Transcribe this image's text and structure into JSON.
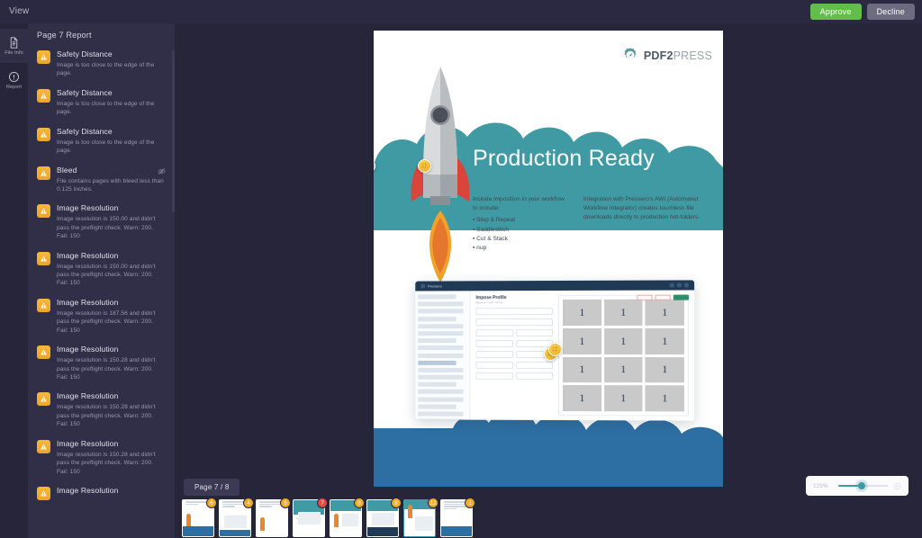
{
  "topbar": {
    "menu": [
      "View"
    ],
    "approve_label": "Approve",
    "decline_label": "Decline"
  },
  "rail": {
    "items": [
      {
        "label": "File Info",
        "icon": "document-icon",
        "active": false
      },
      {
        "label": "Report",
        "icon": "info-circle-icon",
        "active": false
      }
    ]
  },
  "sidebar": {
    "title": "Page 7 Report",
    "issues": [
      {
        "title": "Safety Distance",
        "desc": "Image is too close to the edge of the page.",
        "severity": "warning",
        "hidden_icon": false
      },
      {
        "title": "Safety Distance",
        "desc": "Image is too close to the edge of the page.",
        "severity": "warning",
        "hidden_icon": false
      },
      {
        "title": "Safety Distance",
        "desc": "Image is too close to the edge of the page.",
        "severity": "warning",
        "hidden_icon": false
      },
      {
        "title": "Bleed",
        "desc": "File contains pages with bleed less than 0.125 inches.",
        "severity": "warning",
        "hidden_icon": true
      },
      {
        "title": "Image Resolution",
        "desc": "Image resolution is 150.00 and didn't pass the preflight check. Warn: 200. Fail: 150",
        "severity": "warning",
        "hidden_icon": false
      },
      {
        "title": "Image Resolution",
        "desc": "Image resolution is 150.00 and didn't pass the preflight check. Warn: 200. Fail: 150",
        "severity": "warning",
        "hidden_icon": false
      },
      {
        "title": "Image Resolution",
        "desc": "Image resolution is 187.56 and didn't pass the preflight check. Warn: 200. Fail: 150",
        "severity": "warning",
        "hidden_icon": false
      },
      {
        "title": "Image Resolution",
        "desc": "Image resolution is 150.28 and didn't pass the preflight check. Warn: 200. Fail: 150",
        "severity": "warning",
        "hidden_icon": false
      },
      {
        "title": "Image Resolution",
        "desc": "Image resolution is 150.28 and didn't pass the preflight check. Warn: 200. Fail: 150",
        "severity": "warning",
        "hidden_icon": false
      },
      {
        "title": "Image Resolution",
        "desc": "Image resolution is 150.28 and didn't pass the preflight check. Warn: 200. Fail: 150",
        "severity": "warning",
        "hidden_icon": false
      },
      {
        "title": "Image Resolution",
        "desc": "",
        "severity": "warning",
        "hidden_icon": false
      }
    ]
  },
  "viewer": {
    "page_indicator": "Page 7 / 8",
    "zoom": {
      "level": "125%",
      "fit_icon": "fit-page-icon"
    }
  },
  "document": {
    "logo": {
      "bold": "PDF2",
      "light": "PRESS",
      "icon": "gear-rocket-icon"
    },
    "hero_title": "Production Ready",
    "column_left": {
      "intro": "Include imposition in your workflow to include:",
      "bullets": [
        "Step & Repeat",
        "Saddlestitch",
        "Cut & Stack",
        "nup"
      ]
    },
    "column_right": {
      "text": "Integration with Pressero's AWI (Automated Workflow Integrator) creates touchless file downloads directly to production hot-folders."
    },
    "mockup": {
      "brand": "Pressero",
      "heading": "Impose Profile",
      "subheading": "Business Card - 16 Up",
      "buttons": [
        "Cancel",
        "Discard",
        "Save"
      ],
      "grid_cell_label": "1",
      "grid_rows": 4,
      "grid_cols": 3
    }
  },
  "thumbnails": [
    {
      "badge": "6",
      "severity": "warning",
      "selected": false
    },
    {
      "badge": "4",
      "severity": "warning",
      "selected": false
    },
    {
      "badge": "6",
      "severity": "warning",
      "selected": false
    },
    {
      "badge": "7",
      "severity": "error",
      "selected": false
    },
    {
      "badge": "8",
      "severity": "warning",
      "selected": false
    },
    {
      "badge": "8",
      "severity": "warning",
      "selected": false
    },
    {
      "badge": "12",
      "severity": "warning",
      "selected": true
    },
    {
      "badge": "1",
      "severity": "warning",
      "selected": false
    }
  ],
  "colors": {
    "app_bg": "#272539",
    "sidebar_bg": "#312f48",
    "topbar_bg": "#2b2941",
    "approve_green": "#63bd4a",
    "decline_gray": "#6d6b80",
    "warning_amber": "#f0ab28",
    "error_red": "#e04a3f",
    "accent_teal": "#3f9aa3",
    "doc_blue": "#2d6fa3"
  }
}
